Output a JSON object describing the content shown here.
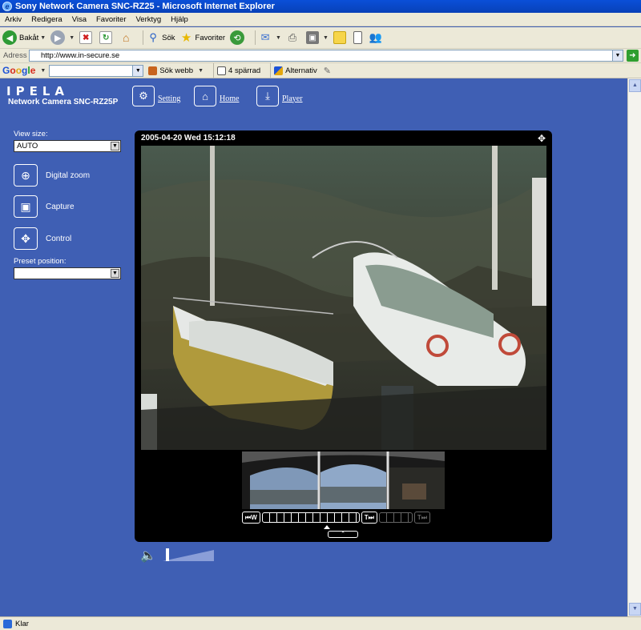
{
  "window": {
    "title": "Sony Network Camera SNC-RZ25 - Microsoft Internet Explorer"
  },
  "menu": [
    "Arkiv",
    "Redigera",
    "Visa",
    "Favoriter",
    "Verktyg",
    "Hjälp"
  ],
  "toolbar": {
    "back_label": "Bakåt",
    "search_label": "Sök",
    "favorites_label": "Favoriter"
  },
  "address": {
    "label": "Adress",
    "url": "http://www.in-secure.se"
  },
  "google": {
    "logo": "Google",
    "search_web": "Sök webb",
    "blocked": "4 spärrad",
    "options": "Alternativ"
  },
  "header": {
    "brand": "IPELA",
    "model": "Network Camera SNC-RZ25P",
    "nav": {
      "setting": "Setting",
      "home": "Home",
      "player": "Player"
    }
  },
  "sidebar": {
    "view_size_label": "View size:",
    "view_size_value": "AUTO",
    "digital_zoom": "Digital zoom",
    "capture": "Capture",
    "control": "Control",
    "preset_label": "Preset position:",
    "preset_value": ""
  },
  "viewer": {
    "timestamp": "2005-04-20 Wed 15:12:18",
    "zoom_wide": "W",
    "zoom_tele": "T",
    "zoom_level": 0.3
  },
  "status": {
    "text": "Klar"
  },
  "icons": {
    "back": "back-arrow-icon",
    "forward": "forward-arrow-icon",
    "stop": "stop-icon",
    "refresh": "refresh-icon",
    "home": "home-icon",
    "search": "search-icon",
    "favorites": "star-icon",
    "history": "history-icon",
    "mail": "mail-icon",
    "print": "print-icon",
    "speaker": "speaker-icon"
  }
}
